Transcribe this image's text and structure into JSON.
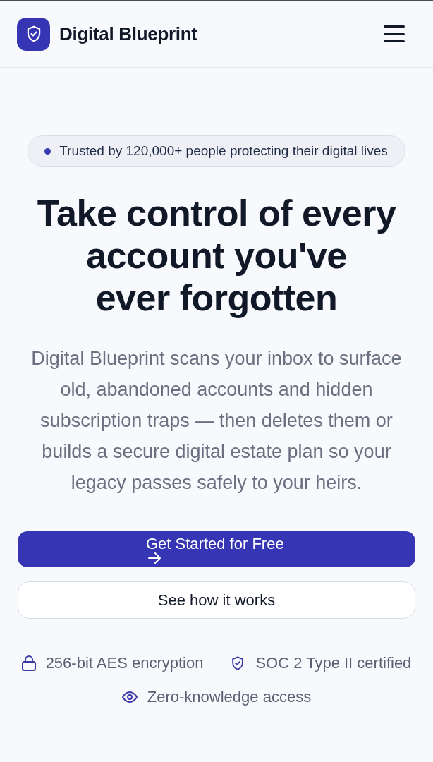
{
  "header": {
    "brand": "Digital Blueprint"
  },
  "badge": {
    "text": "Trusted by 120,000+ people protecting their digital lives"
  },
  "hero": {
    "heading": [
      "Take control of every",
      "account you've",
      "ever forgotten"
    ],
    "description": "Digital Blueprint scans your inbox to surface old, abandoned accounts and hidden subscription traps — then deletes them or builds a secure digital estate plan so your legacy passes safely to your heirs."
  },
  "buttons": [
    {
      "kind": "primary",
      "label": "Get Started for Free"
    },
    {
      "kind": "secondary",
      "label": "See how it works"
    }
  ],
  "features": [
    {
      "kind": "lock",
      "label": "256-bit AES encryption"
    },
    {
      "kind": "shield",
      "label": "SOC 2 Type II certified"
    },
    {
      "kind": "eye",
      "label": "Zero-knowledge access"
    }
  ]
}
